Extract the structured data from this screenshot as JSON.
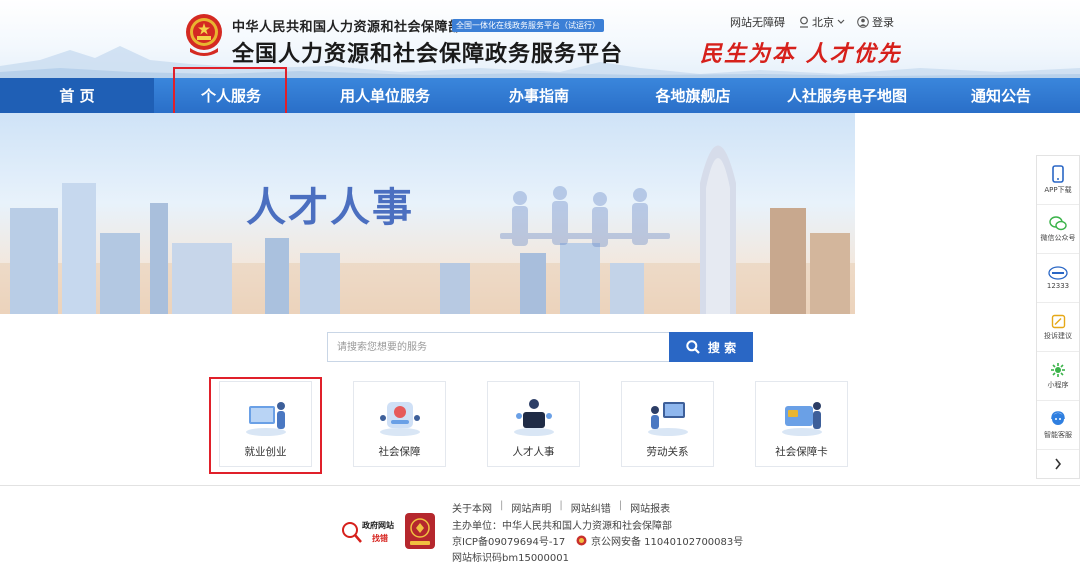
{
  "header": {
    "ministry": "中华人民共和国人力资源和社会保障部",
    "badge": "全国一体化在线政务服务平台（试运行）",
    "platform_title": "全国人力资源和社会保障政务服务平台",
    "slogan": "民生为本 人才优先",
    "accessibility_label": "网站无障碍",
    "location_label": "北京",
    "login_label": "登录"
  },
  "nav": {
    "items": [
      "首 页",
      "个人服务",
      "用人单位服务",
      "办事指南",
      "各地旗舰店",
      "人社服务电子地图",
      "通知公告"
    ]
  },
  "banner": {
    "title": "人才人事"
  },
  "sidebar": {
    "items": [
      "APP下载",
      "微信公众号",
      "12333",
      "投诉建议",
      "小程序",
      "智能客服"
    ]
  },
  "search": {
    "placeholder": "请搜索您想要的服务",
    "button_label": "搜 索"
  },
  "services": {
    "items": [
      "就业创业",
      "社会保障",
      "人才人事",
      "劳动关系",
      "社会保障卡"
    ]
  },
  "footer": {
    "links": [
      "关于本网",
      "网站声明",
      "网站纠错",
      "网站报表"
    ],
    "host": "主办单位：中华人民共和国人力资源和社会保障部",
    "icp": "京ICP备09079694号-17",
    "police": "京公网安备 11040102700083号",
    "site_id": "网站标识码bm15000001",
    "gov_badge_top": "政府网站",
    "gov_badge_bottom": "找错"
  },
  "colors": {
    "nav_blue": "#2a6fc8",
    "nav_home": "#1f5fb5",
    "slogan_red": "#d6201b",
    "highlight_red": "#e0202a",
    "search_blue": "#2a67c5"
  }
}
